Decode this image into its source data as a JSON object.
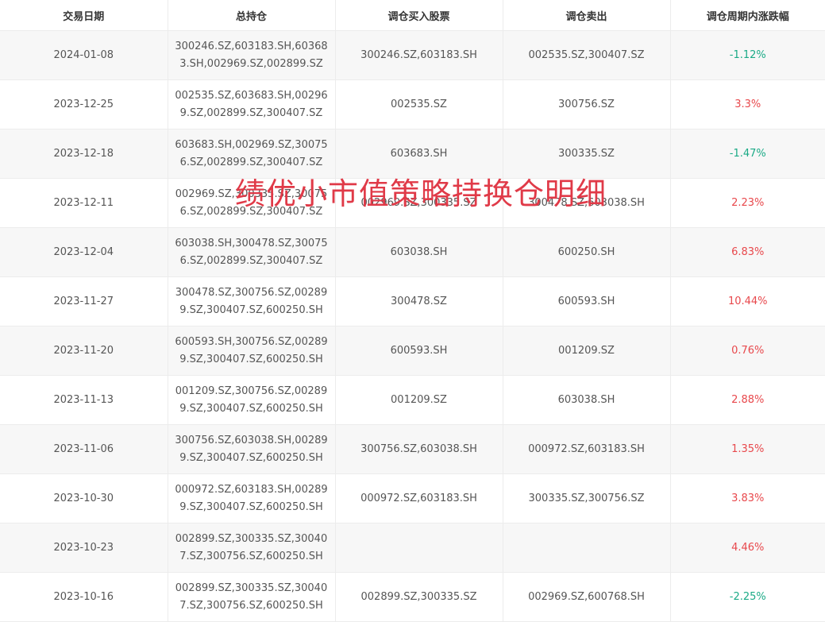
{
  "table": {
    "headers": [
      "交易日期",
      "总持仓",
      "调仓买入股票",
      "调仓卖出",
      "调仓周期内涨跌幅"
    ],
    "rows": [
      {
        "date": "2024-01-08",
        "holdings": "300246.SZ,603183.SH,603683.SH,002969.SZ,002899.SZ",
        "buy": "300246.SZ,603183.SH",
        "sell": "002535.SZ,300407.SZ",
        "change": "-1.12%",
        "dir": "down"
      },
      {
        "date": "2023-12-25",
        "holdings": "002535.SZ,603683.SH,002969.SZ,002899.SZ,300407.SZ",
        "buy": "002535.SZ",
        "sell": "300756.SZ",
        "change": "3.3%",
        "dir": "up"
      },
      {
        "date": "2023-12-18",
        "holdings": "603683.SH,002969.SZ,300756.SZ,002899.SZ,300407.SZ",
        "buy": "603683.SH",
        "sell": "300335.SZ",
        "change": "-1.47%",
        "dir": "down"
      },
      {
        "date": "2023-12-11",
        "holdings": "002969.SZ,300335.SZ,300756.SZ,002899.SZ,300407.SZ",
        "buy": "002969.SZ,300335.SZ",
        "sell": "300478.SZ,603038.SH",
        "change": "2.23%",
        "dir": "up"
      },
      {
        "date": "2023-12-04",
        "holdings": "603038.SH,300478.SZ,300756.SZ,002899.SZ,300407.SZ",
        "buy": "603038.SH",
        "sell": "600250.SH",
        "change": "6.83%",
        "dir": "up"
      },
      {
        "date": "2023-11-27",
        "holdings": "300478.SZ,300756.SZ,002899.SZ,300407.SZ,600250.SH",
        "buy": "300478.SZ",
        "sell": "600593.SH",
        "change": "10.44%",
        "dir": "up"
      },
      {
        "date": "2023-11-20",
        "holdings": "600593.SH,300756.SZ,002899.SZ,300407.SZ,600250.SH",
        "buy": "600593.SH",
        "sell": "001209.SZ",
        "change": "0.76%",
        "dir": "up"
      },
      {
        "date": "2023-11-13",
        "holdings": "001209.SZ,300756.SZ,002899.SZ,300407.SZ,600250.SH",
        "buy": "001209.SZ",
        "sell": "603038.SH",
        "change": "2.88%",
        "dir": "up"
      },
      {
        "date": "2023-11-06",
        "holdings": "300756.SZ,603038.SH,002899.SZ,300407.SZ,600250.SH",
        "buy": "300756.SZ,603038.SH",
        "sell": "000972.SZ,603183.SH",
        "change": "1.35%",
        "dir": "up"
      },
      {
        "date": "2023-10-30",
        "holdings": "000972.SZ,603183.SH,002899.SZ,300407.SZ,600250.SH",
        "buy": "000972.SZ,603183.SH",
        "sell": "300335.SZ,300756.SZ",
        "change": "3.83%",
        "dir": "up"
      },
      {
        "date": "2023-10-23",
        "holdings": "002899.SZ,300335.SZ,300407.SZ,300756.SZ,600250.SH",
        "buy": "",
        "sell": "",
        "change": "4.46%",
        "dir": "up"
      },
      {
        "date": "2023-10-16",
        "holdings": "002899.SZ,300335.SZ,300407.SZ,300756.SZ,600250.SH",
        "buy": "002899.SZ,300335.SZ",
        "sell": "002969.SZ,600768.SH",
        "change": "-2.25%",
        "dir": "down"
      }
    ]
  },
  "watermark": "绩优小市值策略持换仓明细",
  "colors": {
    "up": "#e8484c",
    "down": "#1aaa86",
    "watermark": "#e03a48"
  }
}
